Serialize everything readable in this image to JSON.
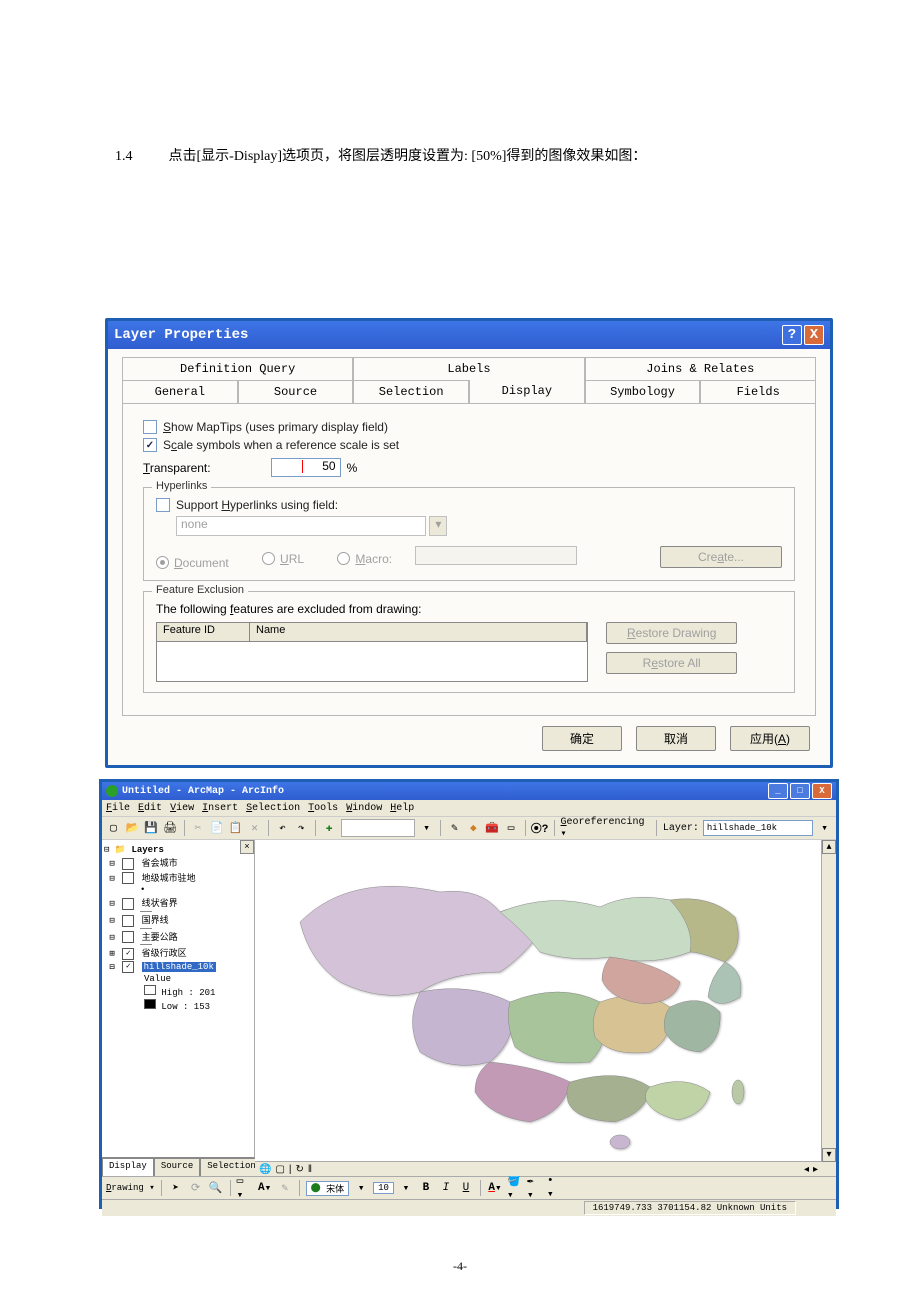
{
  "instruction": {
    "section": "1.4",
    "text": "点击[显示-Display]选项页，将图层透明度设置为: [50%]得到的图像效果如图："
  },
  "dialog": {
    "title": "Layer Properties",
    "tabs_top": [
      "Definition Query",
      "Labels",
      "Joins & Relates"
    ],
    "tabs_bottom": [
      "General",
      "Source",
      "Selection",
      "Display",
      "Symbology",
      "Fields"
    ],
    "show_maptips": "Show MapTips (uses primary display field)",
    "scale_symbols": "Scale symbols when a reference scale is set",
    "transparent_label": "Transparent:",
    "transparent_value": "50",
    "transparent_unit": "%",
    "hyperlinks_legend": "Hyperlinks",
    "support_hyperlinks": "Support Hyperlinks using field:",
    "field_value": "none",
    "radio_document": "Document",
    "radio_url": "URL",
    "radio_macro": "Macro:",
    "create_btn": "Create...",
    "exclusion_legend": "Feature Exclusion",
    "exclusion_text": "The following features are excluded from drawing:",
    "col_feature_id": "Feature ID",
    "col_name": "Name",
    "restore_drawing": "Restore Drawing",
    "restore_all": "Restore All",
    "ok": "确定",
    "cancel": "取消",
    "apply": "应用(A)"
  },
  "app": {
    "title": "Untitled - ArcMap - ArcInfo",
    "menus": [
      "File",
      "Edit",
      "View",
      "Insert",
      "Selection",
      "Tools",
      "Window",
      "Help"
    ],
    "georeferencing": "Georeferencing",
    "layer_label": "Layer:",
    "layer_value": "hillshade_10k",
    "toc_root": "Layers",
    "toc": [
      {
        "label": "省会城市",
        "checked": false
      },
      {
        "label": "地级城市驻地",
        "checked": false
      },
      {
        "label": "线状省界",
        "checked": false,
        "dot": true
      },
      {
        "label": "国界线",
        "checked": false
      },
      {
        "label": "主要公路",
        "checked": false
      },
      {
        "label": "省级行政区",
        "checked": true
      },
      {
        "label": "hillshade_10k",
        "checked": true,
        "selected": true
      }
    ],
    "value_label": "Value",
    "high_label": "High : 201",
    "low_label": "Low : 153",
    "toc_tabs": [
      "Display",
      "Source",
      "Selection"
    ],
    "drawing_label": "Drawing",
    "font_name": "宋体",
    "font_size": "10",
    "status": "1619749.733  3701154.82 Unknown Units"
  },
  "page_number": "-4-"
}
